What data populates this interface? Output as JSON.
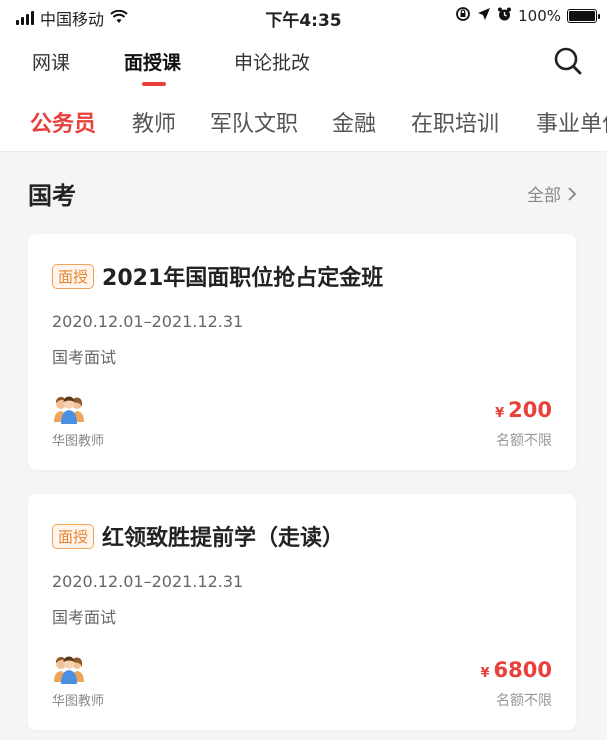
{
  "status_bar": {
    "carrier": "中国移动",
    "time": "下午4:35",
    "battery": "100%",
    "battery_level": 1.0
  },
  "top_nav": {
    "tabs": [
      {
        "label": "网课"
      },
      {
        "label": "面授课"
      },
      {
        "label": "申论批改"
      }
    ],
    "active_index": 1
  },
  "category_nav": {
    "tabs": [
      {
        "label": "公务员"
      },
      {
        "label": "教师"
      },
      {
        "label": "军队文职"
      },
      {
        "label": "金融"
      },
      {
        "label": "在职培训"
      },
      {
        "label": "事业单位"
      }
    ],
    "active_index": 0
  },
  "section": {
    "title": "国考",
    "more_label": "全部"
  },
  "courses": [
    {
      "badge": "面授",
      "title": "2021年国面职位抢占定金班",
      "date_range": "2020.12.01–2021.12.31",
      "type": "国考面试",
      "teacher": "华图教师",
      "currency": "¥",
      "price": "200",
      "quota": "名额不限"
    },
    {
      "badge": "面授",
      "title": "红领致胜提前学（走读）",
      "date_range": "2020.12.01–2021.12.31",
      "type": "国考面试",
      "teacher": "华图教师",
      "currency": "¥",
      "price": "6800",
      "quota": "名额不限"
    }
  ],
  "colors": {
    "accent": "#e8403b",
    "badge": "#e8862f",
    "background": "#f5f5f5"
  }
}
